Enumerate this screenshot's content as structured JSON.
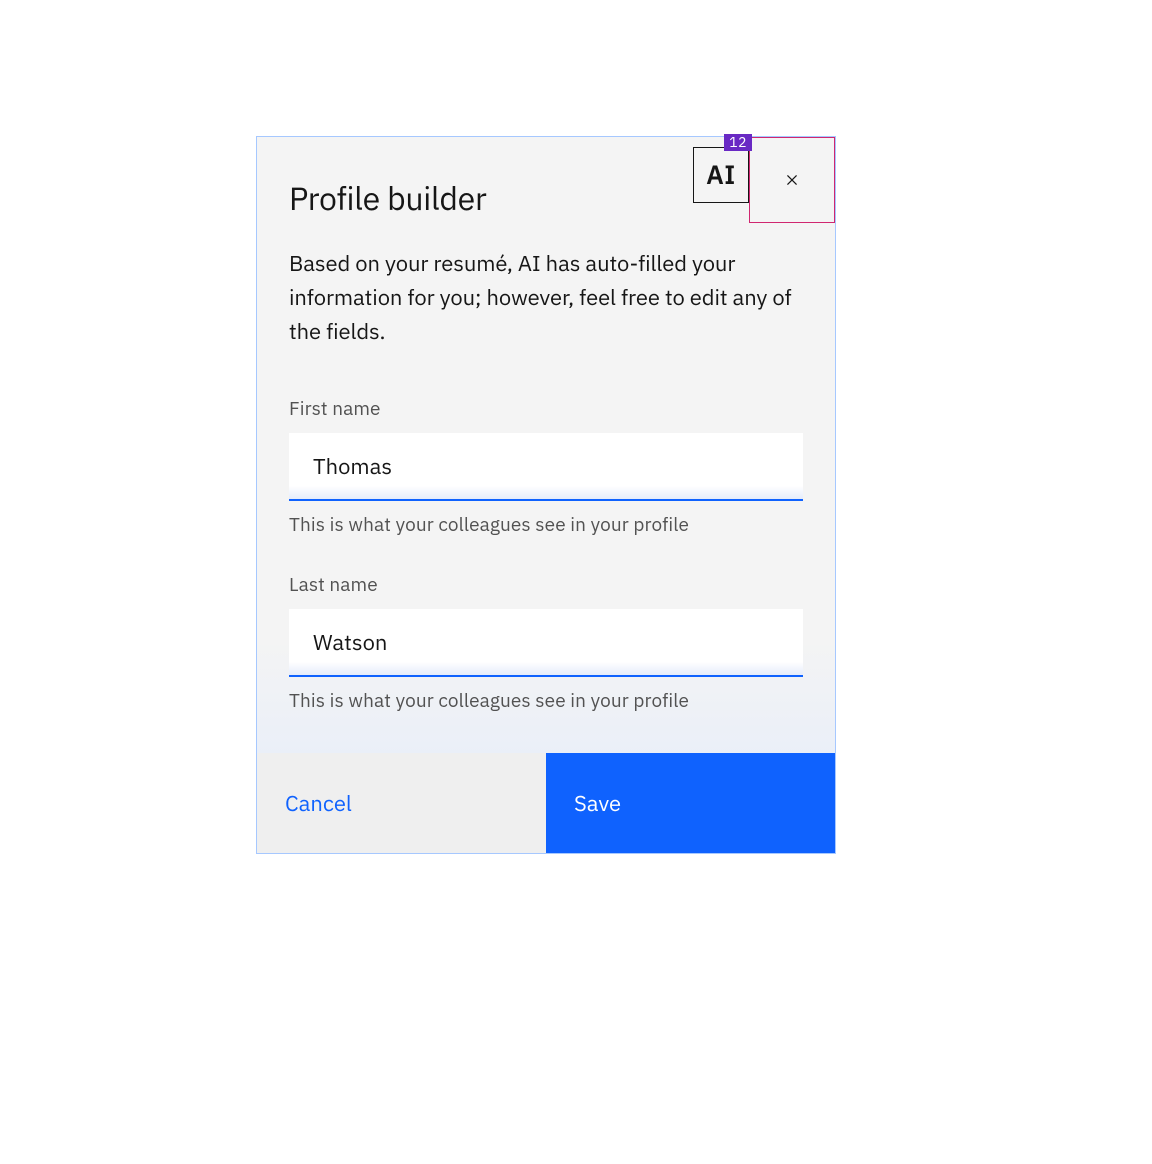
{
  "modal": {
    "title": "Profile builder",
    "ai_label": "AI",
    "ai_count": "12",
    "description": "Based on your resumé, AI has auto-filled your information for you; however, feel free to edit any of the fields.",
    "fields": {
      "first_name": {
        "label": "First name",
        "value": "Thomas",
        "helper": "This is what your colleagues see in your profile"
      },
      "last_name": {
        "label": "Last name",
        "value": "Watson",
        "helper": "This is what your colleagues see in your profile"
      }
    },
    "actions": {
      "cancel": "Cancel",
      "save": "Save"
    }
  }
}
